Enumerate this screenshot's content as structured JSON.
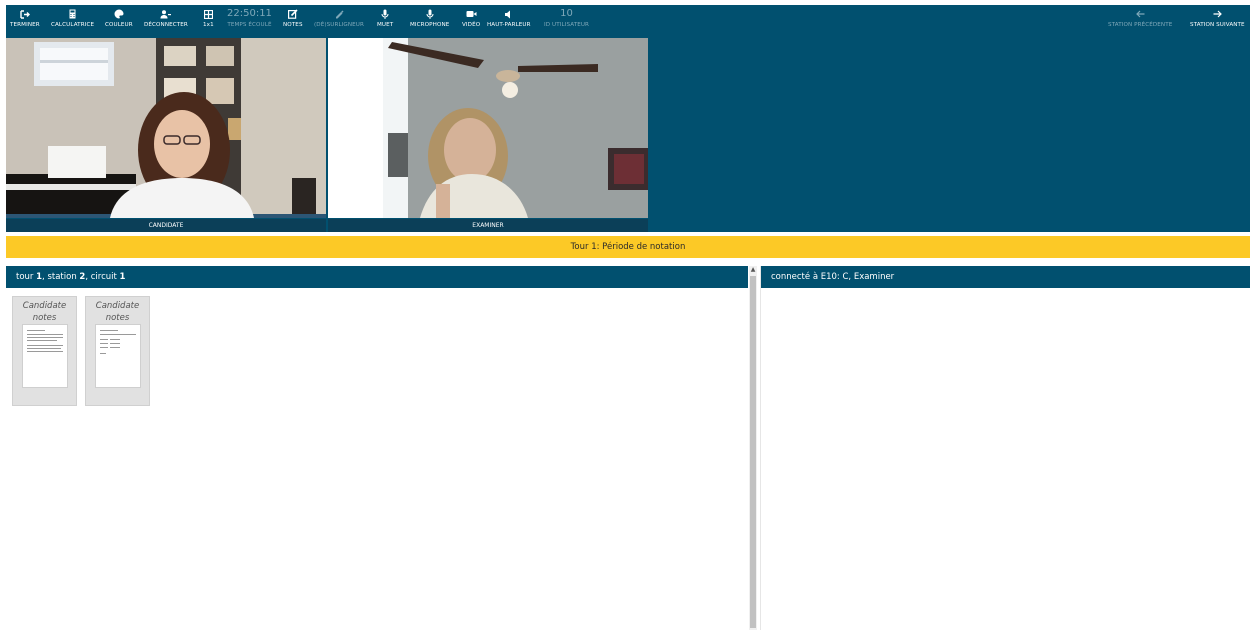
{
  "toolbar": {
    "end": "TERMINER",
    "calculator": "CALCULATRICE",
    "color": "COULEUR",
    "disconnect": "DÉCONNECTER",
    "layout": "1x1",
    "elapsed_value": "22:50:11",
    "elapsed_label": "TEMPS ÉCOULÉ",
    "notes": "NOTES",
    "highlighter": "(DÉ)SURLIGNEUR",
    "mute": "MUET",
    "microphone": "MICROPHONE",
    "video": "VIDÉO",
    "speaker": "HAUT-PARLEUR",
    "user_id_value": "10",
    "user_id_label": "ID UTILISATEUR",
    "prev_station": "STATION PRÉCÉDENTE",
    "next_station": "STATION SUIVANTE"
  },
  "videos": {
    "left_label": "CANDIDATE",
    "right_label": "EXAMINER"
  },
  "banner": "Tour 1: Période de notation",
  "left_panel": {
    "prefix1": "tour ",
    "tour": "1",
    "prefix2": ", station ",
    "station": "2",
    "prefix3": ", circuit ",
    "circuit": "1"
  },
  "right_panel": {
    "header": "connecté à E10: C, Examiner"
  },
  "cards": [
    {
      "title": "Candidate notes"
    },
    {
      "title": "Candidate notes"
    }
  ],
  "colors": {
    "toolbar_bg": "#01506f",
    "banner_bg": "#fcc926",
    "label_bar": "#0b3f58"
  }
}
